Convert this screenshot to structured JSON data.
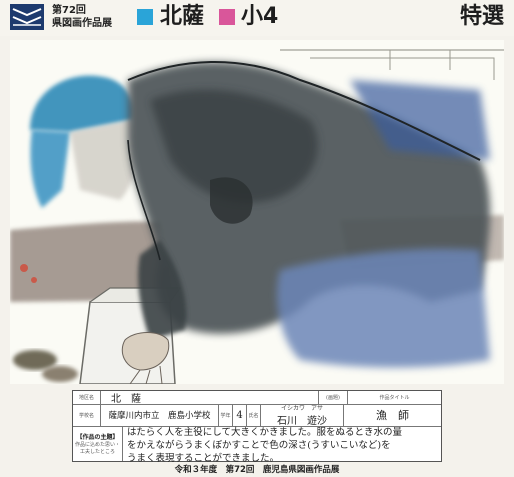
{
  "header": {
    "exhibition_line1": "第72回",
    "exhibition_line2": "県図画作品展",
    "region_color": "#2aa4d8",
    "region": "北薩",
    "grade_color": "#d9569a",
    "grade": "小4",
    "award": "特選"
  },
  "painting": {
    "description_icon": "painting-image"
  },
  "label_card": {
    "region_heading": "地区名",
    "region_value": "北　薩",
    "school_heading": "学校名",
    "school_value": "薩摩川内市立　鹿島小学校",
    "grade_heading": "学年",
    "grade_value": "4",
    "name_heading": "氏名",
    "name_furigana": "イシカワ　アサ",
    "name_value": "石川　遊沙",
    "title_heading": "作品タイトル",
    "title_prefix": "(画題)",
    "title_value": "漁　師",
    "theme_heading": "【作品の主題】",
    "theme_note": "作品に込めた思い・工夫したところ",
    "comment_line1": "はたらく人を主役にして大きくかきました。服をぬるとき水の量",
    "comment_line2": "をかえながらうまくぼかすことで色の深さ(うすいこいなど)を",
    "comment_line3": "うまく表現することができました。"
  },
  "footer": {
    "text": "令和３年度　第72回　鹿児島県図画作品展"
  }
}
